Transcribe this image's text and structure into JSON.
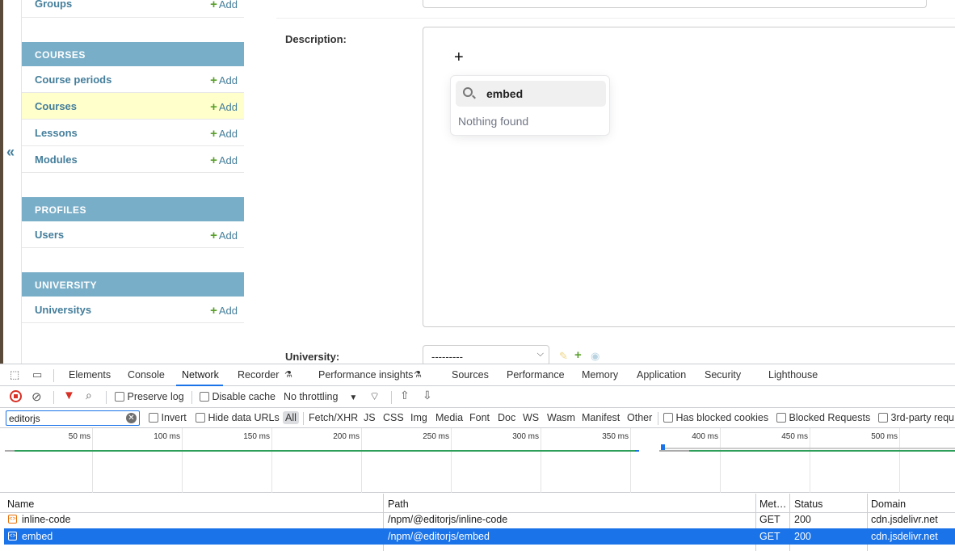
{
  "sidebar": {
    "collapse_icon": "«",
    "add_label": "Add",
    "top_item": "Groups",
    "sections": [
      {
        "caption": "COURSES",
        "items": [
          "Course periods",
          "Courses",
          "Lessons",
          "Modules"
        ]
      },
      {
        "caption": "PROFILES",
        "items": [
          "Users"
        ]
      },
      {
        "caption": "UNIVERSITY",
        "items": [
          "Universitys"
        ]
      }
    ]
  },
  "form": {
    "description_label": "Description:",
    "university_label": "University:",
    "university_value": "---------"
  },
  "editor": {
    "plus": "+",
    "search_value": "embed",
    "nothing_found": "Nothing found"
  },
  "devtools": {
    "tabs": [
      "Elements",
      "Console",
      "Network",
      "Recorder",
      "Performance insights",
      "Sources",
      "Performance",
      "Memory",
      "Application",
      "Security",
      "Lighthouse"
    ],
    "active_tab": "Network",
    "toolbar": {
      "preserve_log": "Preserve log",
      "disable_cache": "Disable cache",
      "throttling": "No throttling"
    },
    "filter": {
      "value": "editorjs",
      "invert": "Invert",
      "hide_data_urls": "Hide data URLs",
      "types": [
        "All",
        "Fetch/XHR",
        "JS",
        "CSS",
        "Img",
        "Media",
        "Font",
        "Doc",
        "WS",
        "Wasm",
        "Manifest",
        "Other"
      ],
      "has_blocked_cookies": "Has blocked cookies",
      "blocked_requests": "Blocked Requests",
      "third_party": "3rd-party requ"
    },
    "timeline_ticks": [
      "50 ms",
      "100 ms",
      "150 ms",
      "200 ms",
      "250 ms",
      "300 ms",
      "350 ms",
      "400 ms",
      "450 ms",
      "500 ms"
    ],
    "columns": [
      "Name",
      "Path",
      "Met…",
      "Status",
      "Domain"
    ],
    "rows": [
      {
        "name": "inline-code",
        "path": "/npm/@editorjs/inline-code",
        "method": "GET",
        "status": "200",
        "domain": "cdn.jsdelivr.net"
      },
      {
        "name": "embed",
        "path": "/npm/@editorjs/embed",
        "method": "GET",
        "status": "200",
        "domain": "cdn.jsdelivr.net"
      }
    ]
  },
  "colors": {
    "accent": "#1a73e8",
    "admin_header": "#79aec8",
    "link": "#447e9b",
    "add_plus": "#5aa02c",
    "highlight_row": "#ffffcc"
  }
}
